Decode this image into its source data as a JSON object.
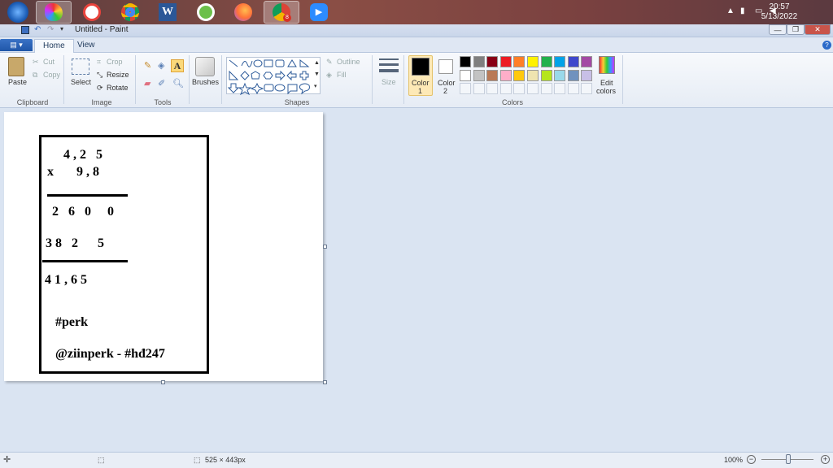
{
  "taskbar": {
    "time": "20:57",
    "date": "5/13/2022",
    "badge": "8",
    "apps": [
      "start-orb",
      "paint",
      "photos",
      "chrome",
      "word",
      "vectr",
      "firefox",
      "chrome-profile",
      "zoom"
    ]
  },
  "window": {
    "title": "Untitled - Paint"
  },
  "tabs": {
    "home": "Home",
    "view": "View"
  },
  "clipboard": {
    "paste": "Paste",
    "cut": "Cut",
    "copy": "Copy",
    "group": "Clipboard"
  },
  "image": {
    "select": "Select",
    "crop": "Crop",
    "resize": "Resize",
    "rotate": "Rotate",
    "group": "Image"
  },
  "tools": {
    "group": "Tools"
  },
  "brushes": {
    "label": "Brushes"
  },
  "shapes": {
    "outline": "Outline",
    "fill": "Fill",
    "group": "Shapes"
  },
  "size": {
    "label": "Size"
  },
  "colors": {
    "color1_a": "Color",
    "color1_b": "1",
    "color2_a": "Color",
    "color2_b": "2",
    "edit_a": "Edit",
    "edit_b": "colors",
    "group": "Colors",
    "palette": [
      "#000000",
      "#7f7f7f",
      "#880015",
      "#ed1c24",
      "#ff7f27",
      "#fff200",
      "#22b14c",
      "#00a2e8",
      "#3f48cc",
      "#a349a4",
      "#ffffff",
      "#c3c3c3",
      "#b97a57",
      "#ffaec9",
      "#ffc90e",
      "#efe4b0",
      "#b5e61d",
      "#99d9ea",
      "#7092be",
      "#c8bfe7"
    ]
  },
  "drawing": {
    "line1": "4 , 2   5",
    "line2": "x       9 , 8",
    "line3": "2   6   0     0",
    "line4": "3 8   2      5",
    "line5": "4 1 , 6 5",
    "line6": "#perk",
    "line7": "@ziinperk - #hđ247"
  },
  "status": {
    "dimensions": "525 × 443px",
    "zoom": "100%"
  }
}
